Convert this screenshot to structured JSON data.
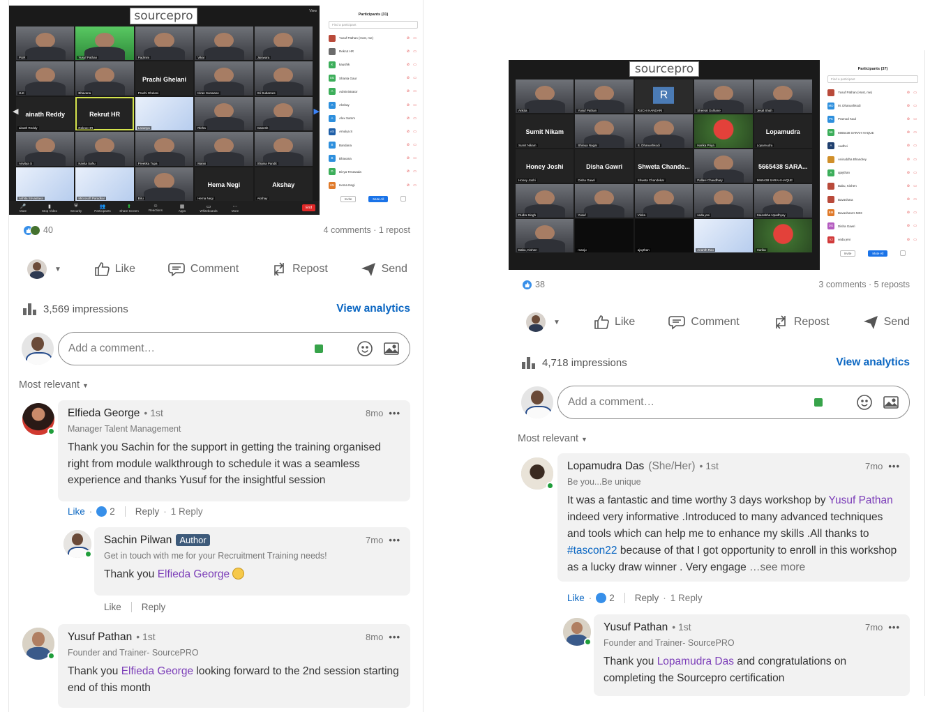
{
  "posts": [
    {
      "zoom": {
        "logo": "sourcepro",
        "view_label": "View",
        "tiles": [
          {
            "label": "PUR",
            "kind": "cam"
          },
          {
            "label": "Yusuf Pathan",
            "kind": "green"
          },
          {
            "label": "Padmini",
            "kind": "cam"
          },
          {
            "label": "Vikar",
            "kind": "cam"
          },
          {
            "label": "Jaiswara",
            "kind": "cam"
          },
          {
            "label": "JLK",
            "kind": "cam"
          },
          {
            "label": "Bhavana",
            "kind": "cam"
          },
          {
            "label": "Prachi Ghelani",
            "big": "Prachi Ghelani",
            "kind": "name-only"
          },
          {
            "label": "Kiran Sonwane",
            "kind": "cam"
          },
          {
            "label": "Sri Subarnes",
            "kind": "cam"
          },
          {
            "label": "ainath Reddy",
            "big": "ainath Reddy",
            "kind": "name-only"
          },
          {
            "label": "Rekrut HR",
            "big": "Rekrut HR",
            "kind": "name-only",
            "highlight": true
          },
          {
            "label": "Lavanya",
            "kind": "poster"
          },
          {
            "label": "Richa",
            "kind": "cam"
          },
          {
            "label": "Ganesh",
            "kind": "cam"
          },
          {
            "label": "Anvitya S",
            "kind": "cam"
          },
          {
            "label": "Kavita Sahu",
            "kind": "cam"
          },
          {
            "label": "Preetika Tupa",
            "kind": "cam"
          },
          {
            "label": "Mansi",
            "kind": "cam"
          },
          {
            "label": "Shaina Pandit",
            "kind": "cam"
          },
          {
            "label": "Ashita Srivastava",
            "kind": "poster"
          },
          {
            "label": "Microsoft Paradkar",
            "kind": "poster"
          },
          {
            "label": "Biru",
            "kind": "cam"
          },
          {
            "label": "Hema Negi",
            "big": "Hema Negi",
            "kind": "name-only"
          },
          {
            "label": "Akshay",
            "big": "Akshay",
            "kind": "name-only"
          }
        ],
        "toolbar": [
          "Mute",
          "Stop Video",
          "Security",
          "Participants",
          "Share Screen",
          "Reactions",
          "Apps",
          "Whiteboards",
          "More"
        ],
        "end_label": "End",
        "participants_title": "Participants (31)",
        "search_placeholder": "Find a participant",
        "participants": [
          {
            "name": "Yusuf Pathan (Host, me)",
            "color": "#b94a3a",
            "init": ""
          },
          {
            "name": "Rekrut HR",
            "color": "#6b6b6b",
            "init": ""
          },
          {
            "name": "kaushik",
            "color": "#3cae5a",
            "init": "K"
          },
          {
            "name": "Shanta Gaur",
            "color": "#3cae5a",
            "init": "SG"
          },
          {
            "name": "Administrator",
            "color": "#3cae5a",
            "init": "A"
          },
          {
            "name": "Akshay",
            "color": "#2d8fdd",
            "init": "A"
          },
          {
            "name": "Alex Samm",
            "color": "#2d8fdd",
            "init": "A"
          },
          {
            "name": "Amulya S",
            "color": "#1f5fa8",
            "init": "AS"
          },
          {
            "name": "Bandana",
            "color": "#2d8fdd",
            "init": "B"
          },
          {
            "name": "Bhavana",
            "color": "#2d8fdd",
            "init": "B"
          },
          {
            "name": "Divya Tenavada",
            "color": "#3cae5a",
            "init": "D"
          },
          {
            "name": "Hema Negi",
            "color": "#e07a2a",
            "init": "HN"
          }
        ],
        "buttons": [
          "Invite",
          "Mute All"
        ]
      },
      "reactions_count": "40",
      "comments_reposts": "4 comments · 1 repost",
      "actions": [
        "Like",
        "Comment",
        "Repost",
        "Send"
      ],
      "impressions": "3,569 impressions",
      "view_analytics": "View analytics",
      "add_comment_placeholder": "Add a comment…",
      "sort_label": "Most relevant",
      "comments": [
        {
          "name": "Elfieda George",
          "degree": "• 1st",
          "time": "8mo",
          "headline": "Manager Talent Management",
          "text": "Thank you Sachin for the support in getting the training organised right from module walkthrough to schedule it was a seamless experience and thanks Yusuf for the insightful session",
          "like": "Like",
          "likes_count": "2",
          "reply": "Reply",
          "replies": "1 Reply"
        },
        {
          "name": "Sachin Pilwan",
          "badge": "Author",
          "time": "7mo",
          "headline": "Get in touch with me for your Recruitment Training needs!",
          "text_before": "Thank you ",
          "mention": "Elfieda George",
          "like": "Like",
          "reply": "Reply"
        },
        {
          "name": "Yusuf Pathan",
          "degree": "• 1st",
          "time": "8mo",
          "headline": "Founder and Trainer- SourcePRO",
          "text_before": "Thank you ",
          "mention": "Elfieda George",
          "text_after": " looking forward to the 2nd session starting end of this month"
        }
      ]
    },
    {
      "zoom": {
        "logo": "sourcepro",
        "tiles": [
          {
            "label": "Ankita",
            "kind": "cam"
          },
          {
            "label": "Yusuf Pathan",
            "kind": "cam",
            "highlight": true
          },
          {
            "label": "RUCHI KANDARI",
            "kind": "avatar-r"
          },
          {
            "label": "Sheetal Gulhane",
            "kind": "cam"
          },
          {
            "label": "Jesal Shah",
            "kind": "cam"
          },
          {
            "label": "Sumit Nikam",
            "big": "Sumit Nikam",
            "kind": "name-only"
          },
          {
            "label": "Shreya Nagar",
            "kind": "cam"
          },
          {
            "label": "S. Dhanushkodi",
            "kind": "cam"
          },
          {
            "label": "Harika Priya",
            "kind": "flower"
          },
          {
            "label": "Lopamudra",
            "big": "Lopamudra",
            "kind": "name-only"
          },
          {
            "label": "Honey Joshi",
            "big": "Honey Joshi",
            "kind": "name-only"
          },
          {
            "label": "Disha Gawri",
            "big": "Disha Gawri",
            "kind": "name-only"
          },
          {
            "label": "Shweta Chandekar",
            "big": "Shweta Chande...",
            "kind": "name-only"
          },
          {
            "label": "Pallavi Chaudhary",
            "kind": "cam"
          },
          {
            "label": "5665438 SARAH HAQUE",
            "big": "5665438 SARA...",
            "kind": "name-only"
          },
          {
            "label": "Rudra Singh",
            "kind": "cam"
          },
          {
            "label": "Yusuf",
            "kind": "cam"
          },
          {
            "label": "Vinita",
            "kind": "cam"
          },
          {
            "label": "veda jeni",
            "kind": "cam"
          },
          {
            "label": "Saurabha Upadhyay",
            "kind": "cam"
          },
          {
            "label": "Babu, Kishen",
            "kind": "cam"
          },
          {
            "label": "manju",
            "kind": "black"
          },
          {
            "label": "ajaythan",
            "kind": "black"
          },
          {
            "label": "Ananth Rao",
            "kind": "poster"
          },
          {
            "label": "Harika",
            "kind": "flower"
          }
        ],
        "participants_title": "Participants (37)",
        "search_placeholder": "Find a participant",
        "participants": [
          {
            "name": "Yusuf Pathan (Host, me)",
            "color": "#b94a3a",
            "init": ""
          },
          {
            "name": "M. Dhanushkodi",
            "color": "#2d8fdd",
            "init": "MD"
          },
          {
            "name": "Pramod Kaul",
            "color": "#2d8fdd",
            "init": "PK"
          },
          {
            "name": "5665438 SARAH HAQUE",
            "color": "#3cae5a",
            "init": "56"
          },
          {
            "name": "Aadhvi",
            "color": "#1f3f6e",
            "init": "A"
          },
          {
            "name": "Aniruddha Bhandrey",
            "color": "#d08f2a",
            "init": ""
          },
          {
            "name": "ajaythan",
            "color": "#3cae5a",
            "init": "A"
          },
          {
            "name": "Babu, Kishen",
            "color": "#b94a3a",
            "init": ""
          },
          {
            "name": "Bavashara",
            "color": "#b94a3a",
            "init": ""
          },
          {
            "name": "Bavashara's M03",
            "color": "#e07a2a",
            "init": "BM"
          },
          {
            "name": "Disha Gawri",
            "color": "#b55cc0",
            "init": "DG"
          },
          {
            "name": "veda jeni",
            "color": "#d13b3b",
            "init": "VJ"
          }
        ],
        "buttons": [
          "Invite",
          "Mute All"
        ]
      },
      "reactions_count": "38",
      "comments_reposts": "3 comments · 5 reposts",
      "actions": [
        "Like",
        "Comment",
        "Repost",
        "Send"
      ],
      "impressions": "4,718 impressions",
      "view_analytics": "View analytics",
      "add_comment_placeholder": "Add a comment…",
      "sort_label": "Most relevant",
      "comments": [
        {
          "name": "Lopamudra Das",
          "pronoun": "(She/Her)",
          "degree": "• 1st",
          "time": "7mo",
          "headline": "Be you...Be unique",
          "text_1": "It was a fantastic and time worthy 3 days workshop by ",
          "mention_1": "Yusuf Pathan",
          "text_2": " indeed very informative .Introduced to many advanced techniques and tools which can help me to enhance my skills .All thanks to ",
          "hashtag": "#tascon22",
          "text_3": " because of that I got opportunity to enroll in this workshop as a lucky draw winner . Very engage",
          "see_more": " …see more",
          "like": "Like",
          "likes_count": "2",
          "reply": "Reply",
          "replies": "1 Reply"
        },
        {
          "name": "Yusuf Pathan",
          "degree": "• 1st",
          "time": "7mo",
          "headline": "Founder and Trainer- SourcePRO",
          "text_before": "Thank you ",
          "mention": "Lopamudra Das",
          "text_after": " and congratulations on completing the Sourcepro certification"
        }
      ]
    }
  ],
  "colors": {
    "link_blue": "#0a66c2",
    "mention_purple": "#7b3db8",
    "online_green": "#1f9d3a",
    "bubble_bg": "#f2f2f2"
  }
}
